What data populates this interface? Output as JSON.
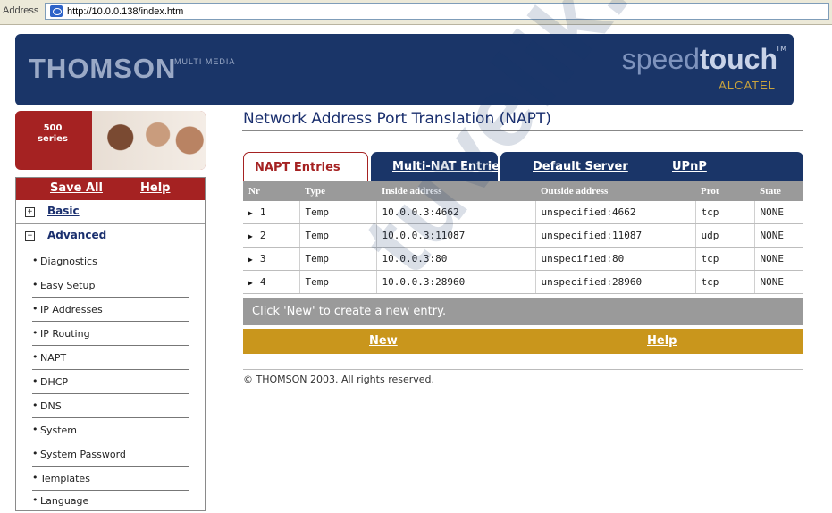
{
  "browser": {
    "address_label": "Address",
    "url": "http://10.0.0.138/index.htm"
  },
  "header": {
    "brand_left": "THOMSON",
    "brand_left_sub": "MULTI MEDIA",
    "brand_right_light": "speed",
    "brand_right_bold": "touch",
    "brand_right_tm": "TM",
    "brand_right_sub": "ALCATEL"
  },
  "sidebar": {
    "series_label_1": "500",
    "series_label_2": "series",
    "save_all": "Save All",
    "help": "Help",
    "top_items": [
      {
        "icon": "plus",
        "label": "Basic"
      },
      {
        "icon": "minus",
        "label": "Advanced"
      }
    ],
    "sub_items": [
      {
        "label": "Diagnostics"
      },
      {
        "label": "Easy Setup"
      },
      {
        "label": "IP Addresses"
      },
      {
        "label": "IP Routing"
      },
      {
        "label": "NAPT"
      },
      {
        "label": "DHCP"
      },
      {
        "label": "DNS"
      },
      {
        "label": "System"
      },
      {
        "label": "System Password"
      },
      {
        "label": "Templates"
      },
      {
        "label": "Language"
      }
    ]
  },
  "main": {
    "title": "Network Address Port Translation (NAPT)",
    "tabs": [
      {
        "label": "NAPT Entries",
        "active": true
      },
      {
        "label": "Multi-NAT Entries",
        "active": false
      },
      {
        "label": "Default Server",
        "active": false
      },
      {
        "label": "UPnP",
        "active": false
      }
    ],
    "table": {
      "columns": [
        "Nr",
        "Type",
        "Inside address",
        "Outside address",
        "Prot",
        "State"
      ],
      "rows": [
        {
          "nr": "1",
          "type": "Temp",
          "inside": "10.0.0.3:4662",
          "outside": "unspecified:4662",
          "prot": "tcp",
          "state": "NONE"
        },
        {
          "nr": "2",
          "type": "Temp",
          "inside": "10.0.0.3:11087",
          "outside": "unspecified:11087",
          "prot": "udp",
          "state": "NONE"
        },
        {
          "nr": "3",
          "type": "Temp",
          "inside": "10.0.0.3:80",
          "outside": "unspecified:80",
          "prot": "tcp",
          "state": "NONE"
        },
        {
          "nr": "4",
          "type": "Temp",
          "inside": "10.0.0.3:28960",
          "outside": "unspecified:28960",
          "prot": "tcp",
          "state": "NONE"
        }
      ]
    },
    "info_text": "Click 'New' to create a new entry.",
    "actions": {
      "new": "New",
      "help": "Help"
    },
    "copyright": "© THOMSON 2003. All rights reserved."
  },
  "watermark": "tuvelik.",
  "colors": {
    "navy": "#1a3568",
    "maroon": "#a52222",
    "gold": "#c9961c",
    "gray_header": "#9a9a9a"
  }
}
